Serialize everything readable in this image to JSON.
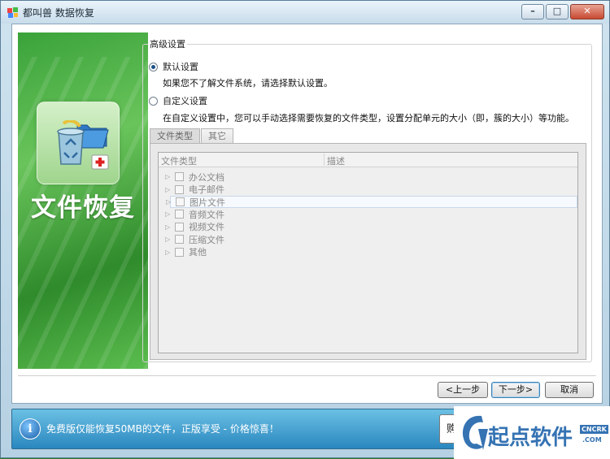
{
  "window": {
    "title": "都叫兽 数据恢复",
    "controls": {
      "minimize": "–",
      "maximize": "□",
      "close": "✕"
    }
  },
  "banner": {
    "title": "文件恢复",
    "icons": [
      "recycle-bin-icon",
      "folder-icon",
      "first-aid-icon"
    ]
  },
  "settings": {
    "group_title": "高级设置",
    "options": [
      {
        "label": "默认设置",
        "selected": true,
        "description": "如果您不了解文件系统，请选择默认设置。"
      },
      {
        "label": "自定义设置",
        "selected": false,
        "description": "在自定义设置中，您可以手动选择需要恢复的文件类型，设置分配单元的大小（即，簇的大小）等功能。"
      }
    ]
  },
  "tabs": [
    {
      "label": "文件类型",
      "active": true
    },
    {
      "label": "其它",
      "active": false
    }
  ],
  "file_list": {
    "columns": [
      "文件类型",
      "描述"
    ],
    "rows": [
      {
        "label": "办公文档",
        "checked": false,
        "selected": false
      },
      {
        "label": "电子邮件",
        "checked": false,
        "selected": false
      },
      {
        "label": "图片文件",
        "checked": false,
        "selected": true
      },
      {
        "label": "音频文件",
        "checked": false,
        "selected": false
      },
      {
        "label": "视频文件",
        "checked": false,
        "selected": false
      },
      {
        "label": "压缩文件",
        "checked": false,
        "selected": false
      },
      {
        "label": "其他",
        "checked": false,
        "selected": false
      }
    ]
  },
  "buttons": {
    "prev": "<上一步",
    "next": "下一步>",
    "cancel": "取消"
  },
  "infobar": {
    "text": "免费版仅能恢复50MB的文件，正版享受 - 价格惊喜！",
    "buy_label": "购"
  },
  "watermark": {
    "brand": "起点软件",
    "tag": "CNCRK",
    "domain": ".COM"
  },
  "colors": {
    "banner_green": "#3aa23a",
    "info_blue": "#2a87bf",
    "watermark_blue": "#3573b3"
  }
}
